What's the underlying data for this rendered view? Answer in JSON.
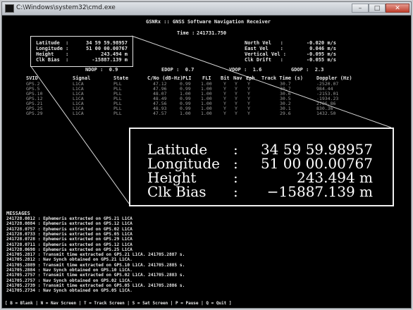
{
  "window": {
    "title": "C:\\Windows\\system32\\cmd.exe",
    "min_glyph": "–",
    "max_glyph": "□",
    "close_glyph": "✕"
  },
  "header": {
    "app_title": "GSNRx :: GNSS Software Navigation Receiver",
    "time_label": "Time :",
    "time_value": "241731.750"
  },
  "position_box": {
    "rows": [
      {
        "label": "Latitude  :",
        "value": "34 59 59.98957"
      },
      {
        "label": "Longitude :",
        "value": "51 00 00.00767"
      },
      {
        "label": "Height    :",
        "value": "243.494 m"
      },
      {
        "label": "Clk Bias  :",
        "value": "-15887.139 m"
      }
    ]
  },
  "velocity": {
    "rows": [
      {
        "label": "North Vel   :",
        "value": "-0.020 m/s"
      },
      {
        "label": "East Vel    :",
        "value": "0.046 m/s"
      },
      {
        "label": "Vertical Vel :",
        "value": "-0.095 m/s"
      },
      {
        "label": "Clk Drift   :",
        "value": "-0.055 m/s"
      }
    ]
  },
  "dop": {
    "ndop": "NDOP :  0.9",
    "edop": "EDOP :  0.7",
    "vdop": "VDOP :  1.6",
    "gdop": "GDOP :  2.3"
  },
  "channel_table": {
    "headers": [
      "SVID",
      "Signal",
      "State",
      "C/No (dB-Hz)",
      "PLI",
      "FLI",
      "Bit",
      "Nav",
      "Eph",
      "Track Time (s)",
      "Doppler (Hz)"
    ],
    "rows": [
      [
        "GPS.2",
        "L1CA",
        "PLL",
        "47.12",
        "0.99",
        "1.00",
        "Y",
        "Y",
        "Y",
        "30.7",
        "-2520.07"
      ],
      [
        "GPS.5",
        "L1CA",
        "PLL",
        "47.96",
        "0.99",
        "1.00",
        "Y",
        "Y",
        "Y",
        "30.7",
        "984.44"
      ],
      [
        "GPS.10",
        "L1CA",
        "PLL",
        "48.07",
        "1.00",
        "1.00",
        "Y",
        "Y",
        "Y",
        "30.6",
        "-2153.01"
      ],
      [
        "GPS.12",
        "L1CA",
        "PLL",
        "48.49",
        "0.99",
        "1.00",
        "Y",
        "Y",
        "Y",
        "30.5",
        "-1934.23"
      ],
      [
        "GPS.21",
        "L1CA",
        "PLL",
        "47.56",
        "0.99",
        "1.00",
        "Y",
        "Y",
        "Y",
        "30.2",
        "2706.86"
      ],
      [
        "GPS.25",
        "L1CA",
        "PLL",
        "48.93",
        "0.99",
        "1.00",
        "Y",
        "Y",
        "Y",
        "30.1",
        "830.36"
      ],
      [
        "GPS.29",
        "L1CA",
        "PLL",
        "47.57",
        "1.00",
        "1.00",
        "Y",
        "Y",
        "Y",
        "29.6",
        "1432.50"
      ]
    ]
  },
  "zoom_box": {
    "rows": [
      {
        "label": "Latitude",
        "sep": ":",
        "value": "34 59 59.98957"
      },
      {
        "label": "Longitude",
        "sep": ":",
        "value": "51 00 00.00767"
      },
      {
        "label": "Height",
        "sep": ":",
        "value": "243.494 m"
      },
      {
        "label": "Clk Bias",
        "sep": ":",
        "value": "−15887.139 m"
      }
    ]
  },
  "messages": {
    "title": "MESSAGES",
    "lines": [
      "241728.0812 : Ephemeris extracted on GPS.21 L1CA",
      "241728.0884 : Ephemeris extracted on GPS.12 L1CA",
      "241728.0757 : Ephemeris extracted on GPS.02 L1CA",
      "241728.0733 : Ephemeris extracted on GPS.05 L1CA",
      "241728.0728 : Ephemeris extracted on GPS.29 L1CA",
      "241728.0711 : Ephemeris extracted on GPS.12 L1CA",
      "241728.0698 : Ephemeris extracted on GPS.25 L1CA",
      "241705.2817 : Transmit time extracted on GPS.21 L1CA. 241705.2887 s.",
      "241705.2812 : Nav Synch obtained on GPS.21 L1CA.",
      "241705.2889 : Transmit time extracted on GPS.10 L1CA. 241705.2885 s.",
      "241705.2884 : Nav Synch obtained on GPS.10 L1CA.",
      "241705.2757 : Transmit time extracted on GPS.02 L1CA. 241705.2883 s.",
      "241705.2757 : Nav Synch obtained on GPS.02 L1CA.",
      "241705.2739 : Transmit time extracted on GPS.05 L1CA. 241705.2886 s.",
      "241705.2734 : Nav Synch obtained on GPS.05 L1CA."
    ]
  },
  "footer": {
    "text": "[ B = Blank | N = Nav Screen | T = Track Screen | S = Sat Screen | P = Pause | Q = Quit ]"
  }
}
